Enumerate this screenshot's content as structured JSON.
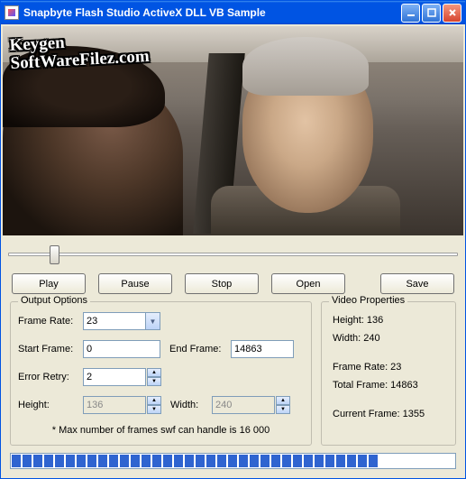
{
  "title": "Snapbyte Flash Studio ActiveX DLL VB Sample",
  "watermark": {
    "line1": "Keygen",
    "line2": "SoftWareFilez.com"
  },
  "slider": {
    "position_pct": 9
  },
  "buttons": {
    "play": "Play",
    "pause": "Pause",
    "stop": "Stop",
    "open": "Open",
    "save": "Save"
  },
  "output": {
    "legend": "Output Options",
    "frame_rate_label": "Frame Rate:",
    "frame_rate_value": "23",
    "start_frame_label": "Start Frame:",
    "start_frame_value": "0",
    "end_frame_label": "End Frame:",
    "end_frame_value": "14863",
    "error_retry_label": "Error Retry:",
    "error_retry_value": "2",
    "height_label": "Height:",
    "height_value": "136",
    "width_label": "Width:",
    "width_value": "240",
    "note": "* Max number of frames swf can  handle is 16 000"
  },
  "props": {
    "legend": "Video Properties",
    "height": "Height: 136",
    "width": "Width: 240",
    "frame_rate": "Frame Rate: 23",
    "total_frame": "Total Frame: 14863",
    "current_frame": "Current Frame: 1355"
  },
  "progress": {
    "filled": 34,
    "total": 41
  }
}
